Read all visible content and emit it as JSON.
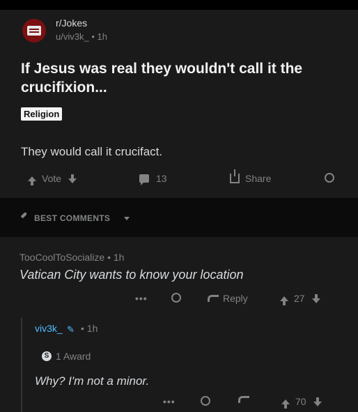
{
  "post": {
    "subreddit": "r/Jokes",
    "author": "u/viv3k_",
    "time": "• 1h",
    "title": "If Jesus was real they wouldn't call it the crucifixion...",
    "flair": "Religion",
    "body": "They would call it crucifact.",
    "actions": {
      "vote_label": "Vote",
      "comment_count": "13",
      "share_label": "Share"
    }
  },
  "sort": {
    "label": "BEST COMMENTS"
  },
  "comments": [
    {
      "author": "TooCoolToSocialize",
      "time": "• 1h",
      "text": "Vatican City wants to know your location",
      "more": "•••",
      "reply_label": "Reply",
      "score": "27"
    },
    {
      "author": "viv3k_",
      "time": "• 1h",
      "award_badge": "S",
      "award": "1 Award",
      "text": "Why? I'm not a minor.",
      "more": "•••",
      "score": "70"
    }
  ],
  "icons": {
    "subreddit_avatar": "jokes-subreddit-icon",
    "upvote": "arrow-up-icon",
    "downvote": "arrow-down-icon",
    "comment": "chat-icon",
    "share": "share-icon",
    "award": "award-icon",
    "sort": "rocket-icon",
    "reply": "reply-icon",
    "flair_author": "pencil-icon"
  },
  "colors": {
    "background": "#0b0b0b",
    "card": "#1a1a1b",
    "text": "#d7dadc",
    "muted": "#818384",
    "username_op": "#4fbcff"
  }
}
